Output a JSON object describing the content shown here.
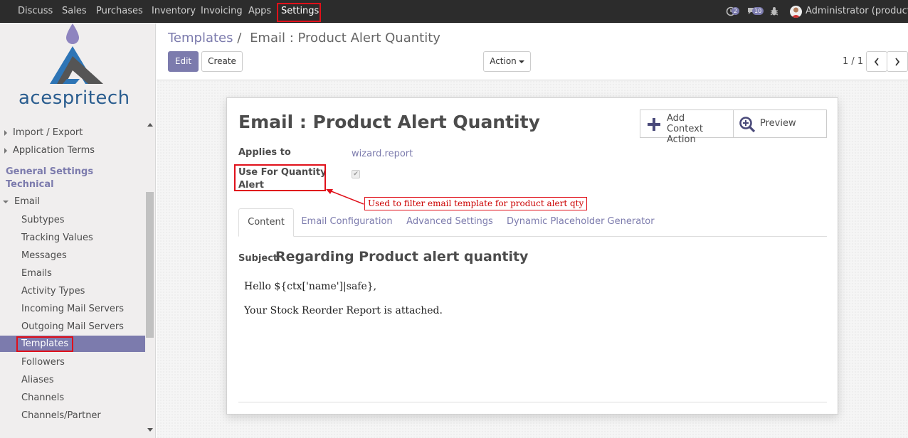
{
  "navbar": {
    "menus": [
      "Discuss",
      "Sales",
      "Purchases",
      "Inventory",
      "Invoicing",
      "Apps",
      "Settings"
    ],
    "active_menu": "Settings",
    "activity_count": "2",
    "message_count": "10",
    "user": "Administrator (product_..."
  },
  "sidebar": {
    "logo_text": "acespritech",
    "items_top": [
      "Import / Export",
      "Application Terms"
    ],
    "sections": [
      "General Settings",
      "Technical"
    ],
    "group": "Email",
    "sub_items": [
      "Subtypes",
      "Tracking Values",
      "Messages",
      "Emails",
      "Activity Types",
      "Incoming Mail Servers",
      "Outgoing Mail Servers",
      "Templates",
      "Followers",
      "Aliases",
      "Channels",
      "Channels/Partner"
    ],
    "active_item": "Templates"
  },
  "control_panel": {
    "breadcrumb_parent": "Templates",
    "breadcrumb_sep": "/",
    "breadcrumb_current": "Email : Product Alert Quantity",
    "edit_label": "Edit",
    "create_label": "Create",
    "action_label": "Action",
    "pager": "1 / 1"
  },
  "form": {
    "title": "Email : Product Alert Quantity",
    "add_context_action": [
      "Add",
      "Context Action"
    ],
    "preview_label": "Preview",
    "applies_to_label": "Applies to",
    "applies_to_value": "wizard.report",
    "use_for_qty_label": [
      "Use For Quantity",
      "Alert"
    ],
    "use_for_qty_checked": true,
    "annotation": "Used to filter email template for product alert qty",
    "tabs": [
      "Content",
      "Email Configuration",
      "Advanced Settings",
      "Dynamic Placeholder Generator"
    ],
    "active_tab": "Content",
    "subject_label": "Subject",
    "subject_value": "Regarding Product alert quantity",
    "body_lines": [
      "Hello ${ctx['name']|safe},",
      "Your Stock Reorder Report is attached."
    ]
  },
  "colors": {
    "brand": "#7c7bad",
    "highlight": "#e0101a",
    "navbar": "#2c2c2c"
  }
}
